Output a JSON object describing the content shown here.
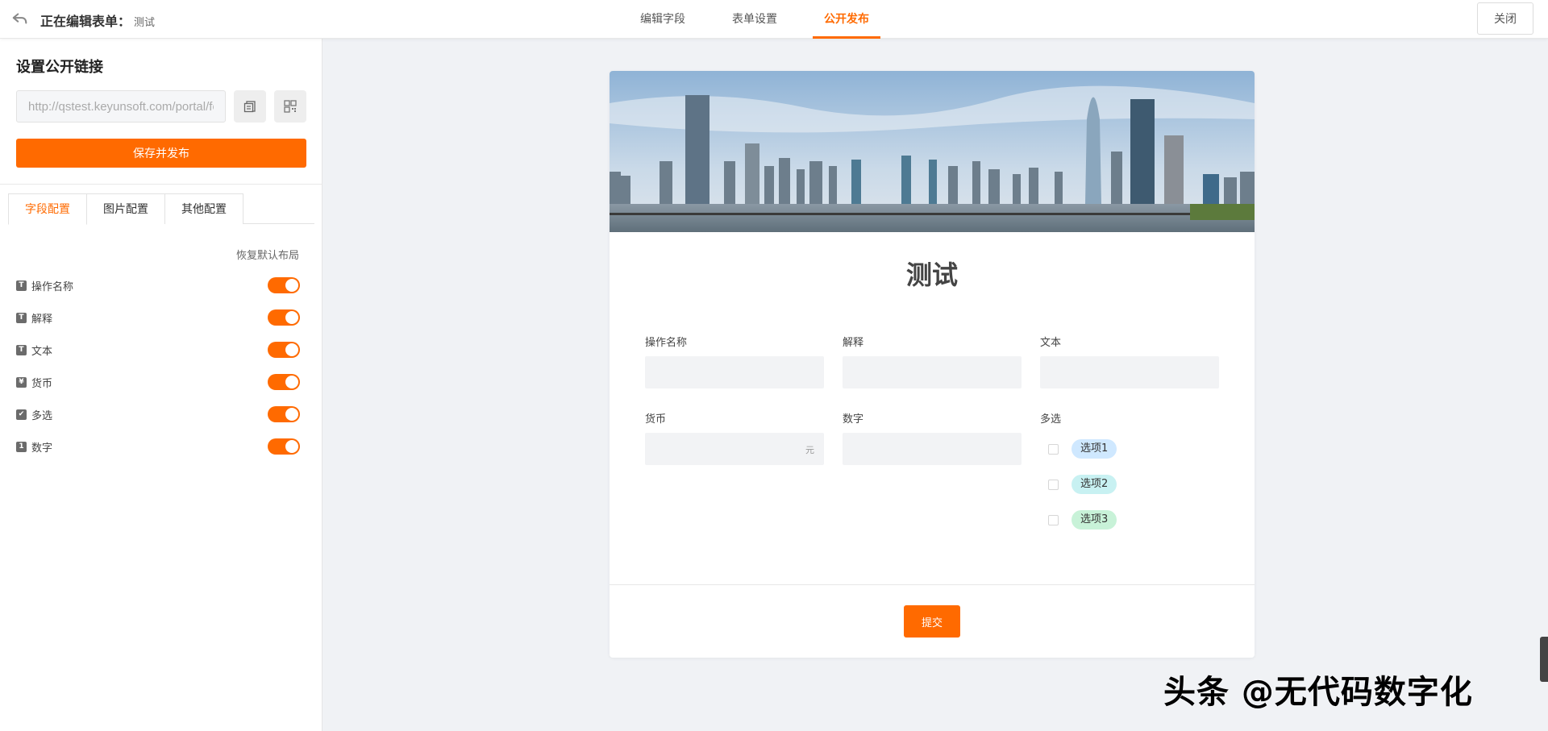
{
  "header": {
    "editing_label": "正在编辑表单：",
    "form_name": "测试",
    "tabs": [
      {
        "label": "编辑字段",
        "active": false
      },
      {
        "label": "表单设置",
        "active": false
      },
      {
        "label": "公开发布",
        "active": true
      }
    ],
    "close_label": "关闭"
  },
  "left_panel": {
    "title": "设置公开链接",
    "url_value": "http://qstest.keyunsoft.com/portal/form",
    "publish_label": "保存并发布",
    "config_tabs": [
      {
        "label": "字段配置",
        "active": true
      },
      {
        "label": "图片配置",
        "active": false
      },
      {
        "label": "其他配置",
        "active": false
      }
    ],
    "restore_label": "恢复默认布局",
    "fields": [
      {
        "name": "操作名称",
        "icon": "T",
        "enabled": true
      },
      {
        "name": "解释",
        "icon": "T",
        "enabled": true
      },
      {
        "name": "文本",
        "icon": "T",
        "enabled": true
      },
      {
        "name": "货币",
        "icon": "¥",
        "enabled": true
      },
      {
        "name": "多选",
        "icon": "✔",
        "enabled": true
      },
      {
        "name": "数字",
        "icon": "1",
        "enabled": true
      }
    ]
  },
  "form": {
    "title": "测试",
    "fields": {
      "op_name": {
        "label": "操作名称"
      },
      "explain": {
        "label": "解释"
      },
      "text": {
        "label": "文本"
      },
      "currency": {
        "label": "货币",
        "suffix": "元"
      },
      "number": {
        "label": "数字"
      },
      "multi": {
        "label": "多选",
        "options": [
          {
            "label": "选项1",
            "color": "#cfe8ff"
          },
          {
            "label": "选项2",
            "color": "#c8f1f2"
          },
          {
            "label": "选项3",
            "color": "#c8f2d8"
          }
        ]
      }
    },
    "submit_label": "提交"
  },
  "watermark": "头条 @无代码数字化",
  "colors": {
    "accent": "#ff6a00"
  }
}
